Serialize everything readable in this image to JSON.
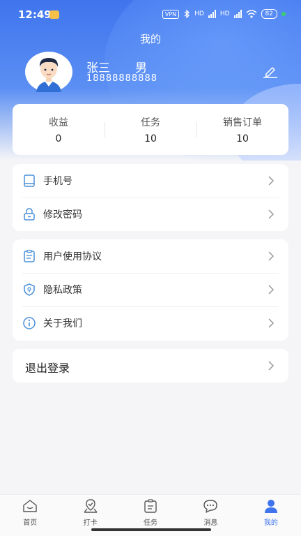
{
  "status_bar": {
    "time": "12:49",
    "vpn": "VPN",
    "net1": "HD",
    "net2": "HD",
    "battery": "82"
  },
  "header": {
    "title": "我的"
  },
  "profile": {
    "name": "张三",
    "gender": "男",
    "phone": "18888888888"
  },
  "stats": [
    {
      "label": "收益",
      "value": "0"
    },
    {
      "label": "任务",
      "value": "10"
    },
    {
      "label": "销售订单",
      "value": "10"
    }
  ],
  "account_menu": [
    {
      "label": "手机号",
      "icon": "phone-icon"
    },
    {
      "label": "修改密码",
      "icon": "lock-icon"
    }
  ],
  "info_menu": [
    {
      "label": "用户使用协议",
      "icon": "clipboard-icon"
    },
    {
      "label": "隐私政策",
      "icon": "shield-icon"
    },
    {
      "label": "关于我们",
      "icon": "info-icon"
    }
  ],
  "logout": {
    "label": "退出登录"
  },
  "tabs": [
    {
      "label": "首页",
      "icon": "home-icon"
    },
    {
      "label": "打卡",
      "icon": "checkin-icon"
    },
    {
      "label": "任务",
      "icon": "task-icon"
    },
    {
      "label": "消息",
      "icon": "message-icon"
    },
    {
      "label": "我的",
      "icon": "profile-icon",
      "active": true
    }
  ],
  "colors": {
    "accent": "#3f74ee",
    "icon": "#4a90d9"
  }
}
